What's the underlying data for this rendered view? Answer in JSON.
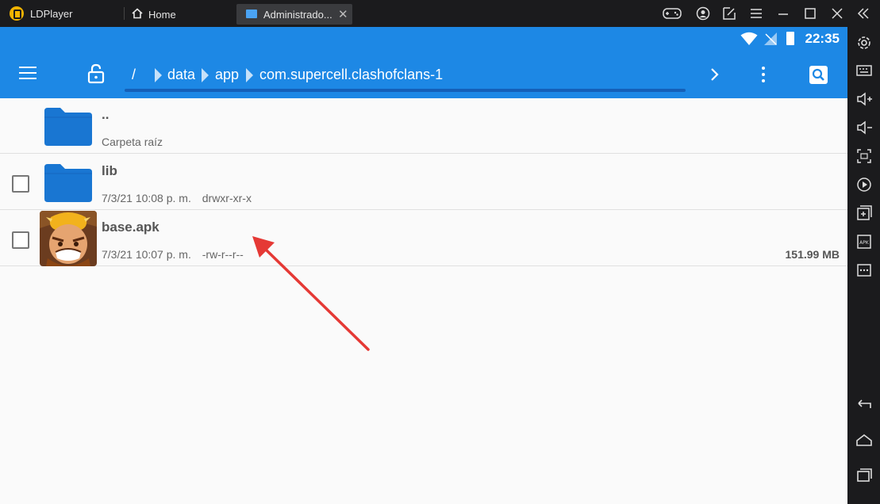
{
  "window": {
    "app_name": "LDPlayer",
    "tabs": [
      {
        "label": "Home",
        "icon": "home-icon"
      },
      {
        "label": "Administrado...",
        "icon": "folder-icon",
        "active": true
      }
    ]
  },
  "status_bar": {
    "time": "22:35"
  },
  "toolbar": {
    "breadcrumbs": [
      "/",
      "data",
      "app",
      "com.supercell.clashofclans-1"
    ]
  },
  "files": [
    {
      "name": "..",
      "subtitle": "Carpeta raíz",
      "type": "folder",
      "checkbox": false
    },
    {
      "name": "lib",
      "date": "7/3/21 10:08 p. m.",
      "permissions": "drwxr-xr-x",
      "type": "folder",
      "checkbox": true
    },
    {
      "name": "base.apk",
      "date": "7/3/21 10:07 p. m.",
      "permissions": "-rw-r--r--",
      "size": "151.99 MB",
      "type": "apk",
      "checkbox": true
    }
  ],
  "colors": {
    "accent": "#1d88e5",
    "annotation_arrow": "#e53935",
    "folder": "#1976d2"
  }
}
